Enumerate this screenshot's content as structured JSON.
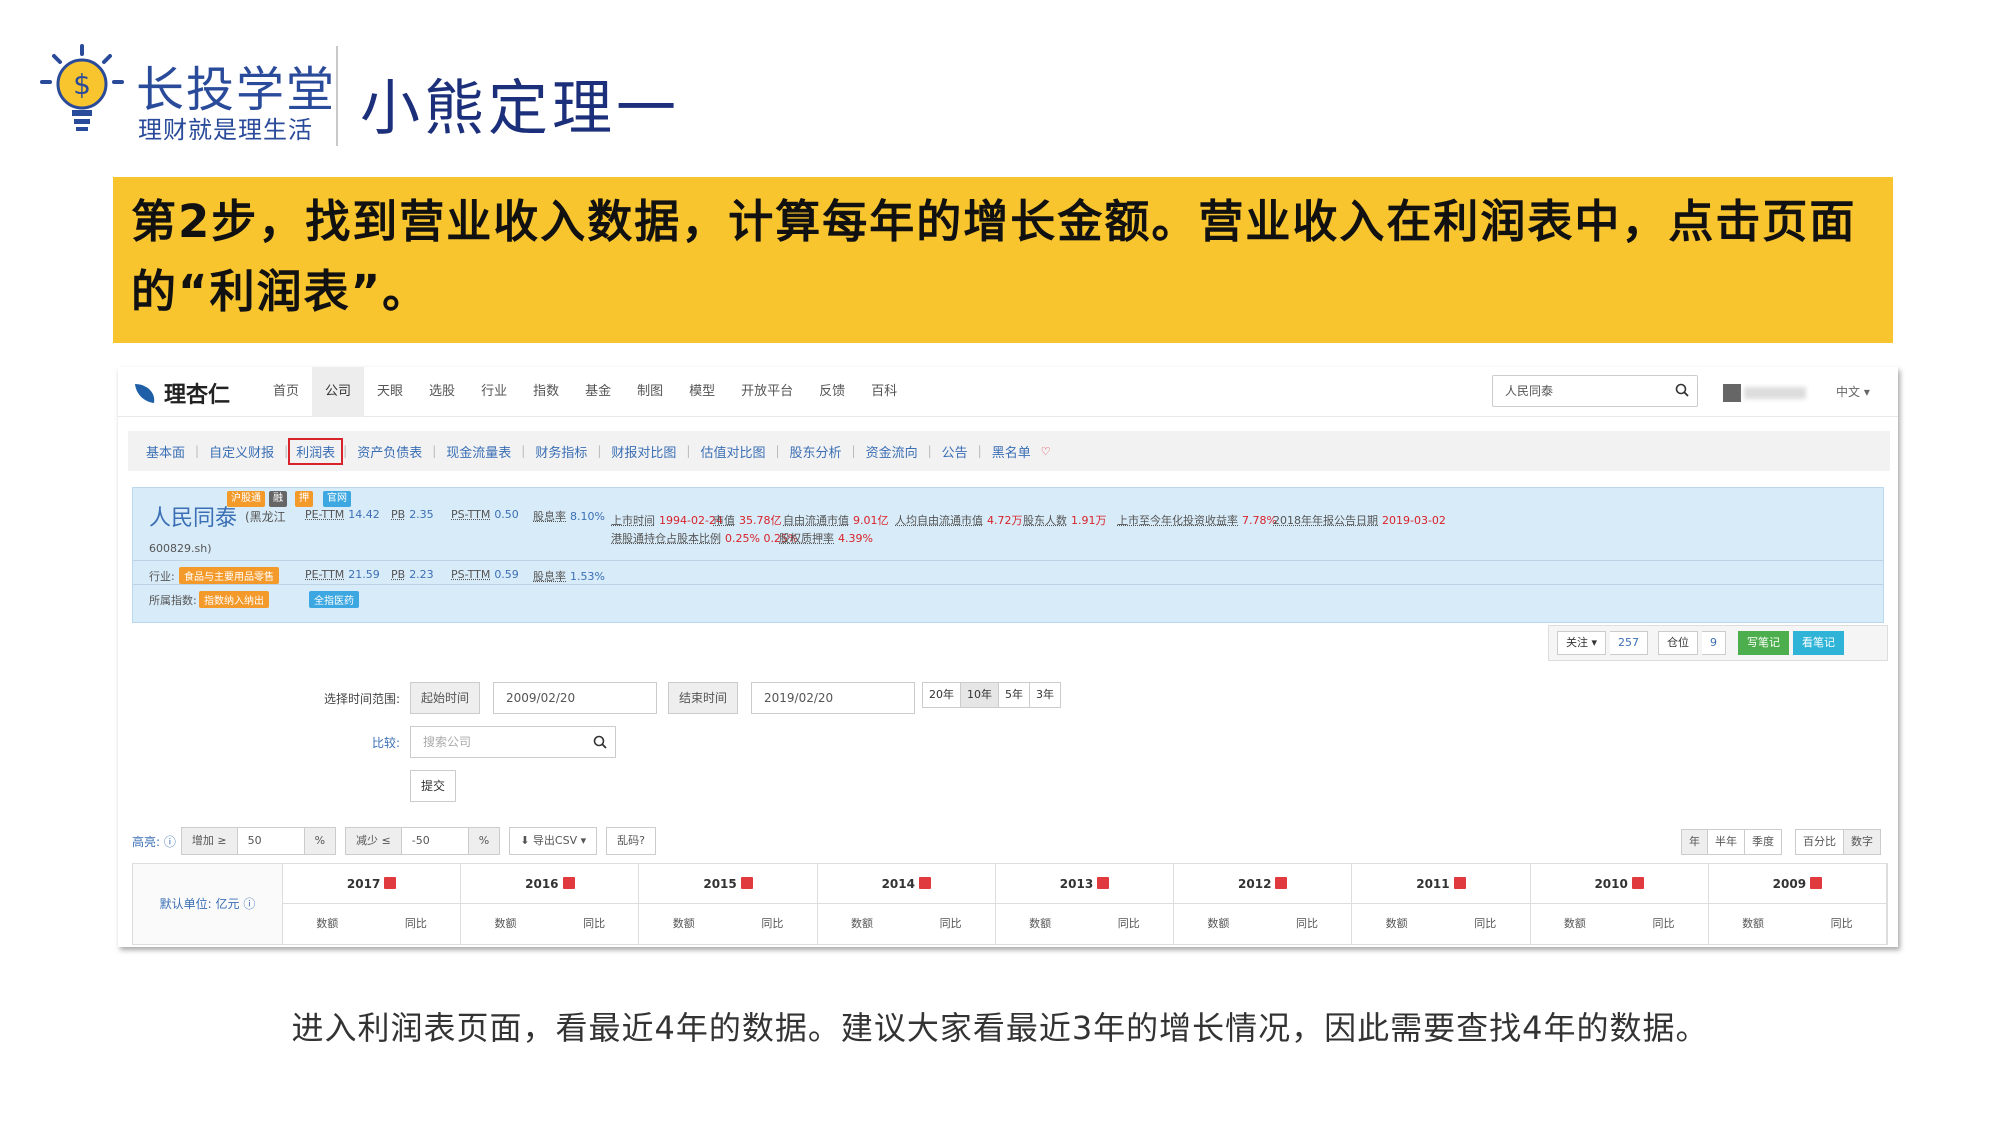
{
  "brand": {
    "name": "长投学堂",
    "tagline": "理财就是理生活"
  },
  "slide_title": "小熊定理一",
  "banner_text": "第2步，找到营业收入数据，计算每年的增长金额。营业收入在利润表中，点击页面的“利润表”。",
  "caption": "进入利润表页面，看最近4年的数据。建议大家看最近3年的增长情况，因此需要查找4年的数据。",
  "site": {
    "logo": "理杏仁",
    "nav": [
      "首页",
      "公司",
      "天眼",
      "选股",
      "行业",
      "指数",
      "基金",
      "制图",
      "模型",
      "开放平台",
      "反馈",
      "百科"
    ],
    "nav_active": 1,
    "search_value": "人民同泰",
    "lang": "中文 ▾"
  },
  "subnav": [
    "基本面",
    "自定义财报",
    "利润表",
    "资产负债表",
    "现金流量表",
    "财务指标",
    "财报对比图",
    "估值对比图",
    "股东分析",
    "资金流向",
    "公告",
    "黑名单"
  ],
  "subnav_highlight": 2,
  "company": {
    "name": "人民同泰",
    "region": "(黑龙江",
    "code": "600829.sh)",
    "badges": [
      "沪股通",
      "融",
      "押",
      "官网"
    ],
    "row1": [
      {
        "label": "PE-TTM",
        "value": "14.42"
      },
      {
        "label": "PB",
        "value": "2.35"
      },
      {
        "label": "PS-TTM",
        "value": "0.50"
      },
      {
        "label": "股息率",
        "value": "8.10%"
      }
    ],
    "row1_right": [
      {
        "label": "上市时间",
        "value": "1994-02-24"
      },
      {
        "label": "市值",
        "value": "35.78亿"
      },
      {
        "label": "自由流通市值",
        "value": "9.01亿"
      },
      {
        "label": "人均自由流通市值",
        "value": "4.72万"
      },
      {
        "label": "股东人数",
        "value": "1.91万"
      },
      {
        "label": "上市至今年化投资收益率",
        "value": "7.78%"
      },
      {
        "label": "2018年年报公告日期",
        "value": "2019-03-02"
      }
    ],
    "row1b": [
      {
        "label": "港股通持仓占股本比例",
        "value": "0.25% 0.25%"
      },
      {
        "label": "股权质押率",
        "value": "4.39%"
      }
    ],
    "row2_label": "行业:",
    "industry": "食品与主要用品零售",
    "row2": [
      {
        "label": "PE-TTM",
        "value": "21.59"
      },
      {
        "label": "PB",
        "value": "2.23"
      },
      {
        "label": "PS-TTM",
        "value": "0.59"
      },
      {
        "label": "股息率",
        "value": "1.53%"
      }
    ],
    "row3_label": "所属指数:",
    "index_tag": "指数纳入纳出",
    "sector_tag": "全指医药"
  },
  "actions": {
    "follow": "关注 ▾",
    "follow_count": "257",
    "position": "仓位",
    "position_count": "9",
    "write_note": "写笔记",
    "view_note": "看笔记"
  },
  "form": {
    "range_label": "选择时间范围:",
    "start_label": "起始时间",
    "start_value": "2009/02/20",
    "end_label": "结束时间",
    "end_value": "2019/02/20",
    "ranges": [
      "20年",
      "10年",
      "5年",
      "3年"
    ],
    "range_active": 1,
    "compare_label": "比较:",
    "compare_placeholder": "搜索公司",
    "submit": "提交"
  },
  "filters": {
    "highlight_label": "高亮: ⓘ",
    "inc_label": "增加 ≥",
    "inc_value": "50",
    "dec_label": "减少 ≤",
    "dec_value": "-50",
    "pct": "%",
    "export": "⬇ 导出CSV ▾",
    "garbled": "乱码?",
    "period": [
      "年",
      "半年",
      "季度"
    ],
    "view": [
      "百分比",
      "数字"
    ]
  },
  "table": {
    "unit": "默认单位: 亿元 ⓘ",
    "years": [
      "2017",
      "2016",
      "2015",
      "2014",
      "2013",
      "2012",
      "2011",
      "2010",
      "2009"
    ],
    "sub_cols": [
      "数额",
      "同比"
    ]
  }
}
